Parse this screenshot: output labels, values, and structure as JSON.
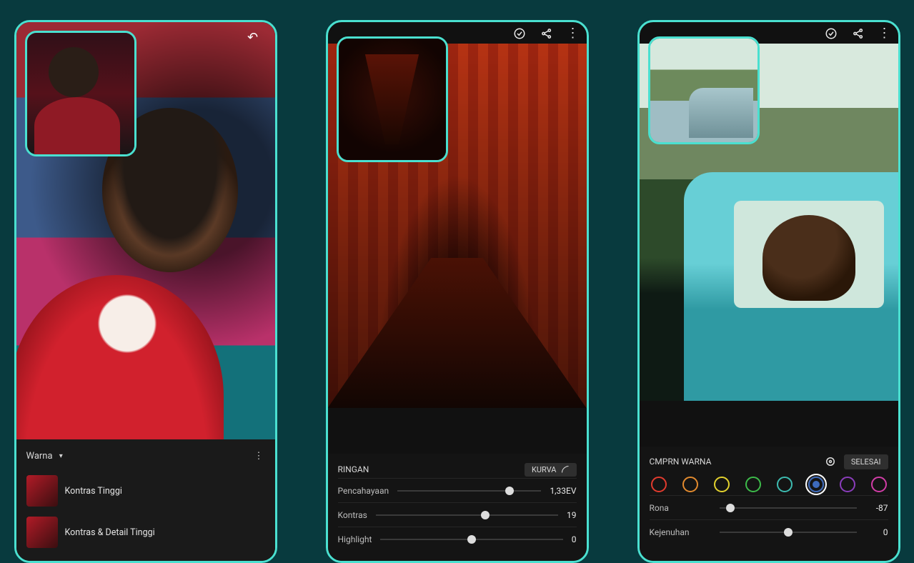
{
  "phone1": {
    "undo_icon": "↶",
    "panel_title": "Warna",
    "presets": [
      {
        "label": "Kontras Tinggi"
      },
      {
        "label": "Kontras & Detail Tinggi"
      }
    ]
  },
  "phone2": {
    "panel_title": "RINGAN",
    "curve_label": "KURVA",
    "sliders": [
      {
        "label": "Pencahayaan",
        "value": "1,33EV",
        "pos": 78
      },
      {
        "label": "Kontras",
        "value": "19",
        "pos": 60
      },
      {
        "label": "Highlight",
        "value": "0",
        "pos": 50
      }
    ]
  },
  "phone3": {
    "panel_title": "CMPRN WARNA",
    "done_label": "SELESAI",
    "colors": [
      {
        "name": "red",
        "hex": "#e23b2e"
      },
      {
        "name": "orange",
        "hex": "#e28a2e"
      },
      {
        "name": "yellow",
        "hex": "#e2d12e"
      },
      {
        "name": "green",
        "hex": "#3dbb4a"
      },
      {
        "name": "aqua",
        "hex": "#3dbbb0"
      },
      {
        "name": "blue",
        "hex": "#3d6abb",
        "active": true
      },
      {
        "name": "purple",
        "hex": "#8a3dbb"
      },
      {
        "name": "magenta",
        "hex": "#d23da7"
      }
    ],
    "sliders": [
      {
        "label": "Rona",
        "value": "-87",
        "pos": 8
      },
      {
        "label": "Kejenuhan",
        "value": "0",
        "pos": 50
      }
    ]
  }
}
